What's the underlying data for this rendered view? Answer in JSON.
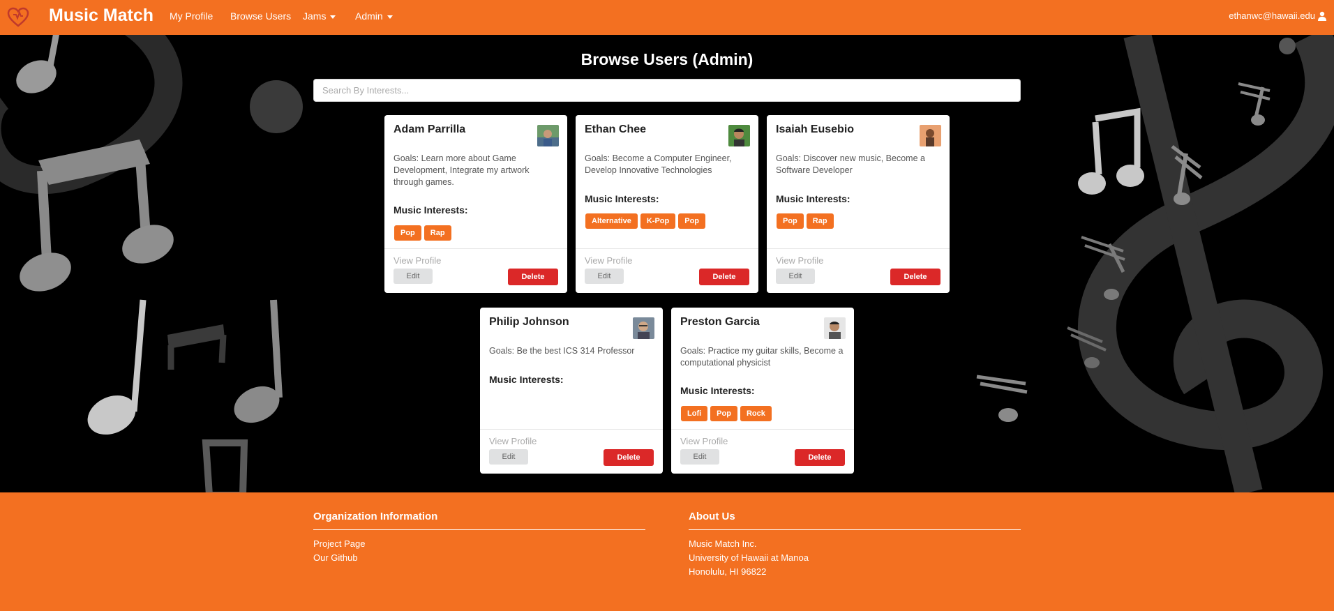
{
  "nav": {
    "brand": "Music Match",
    "links": [
      "My Profile",
      "Browse Users",
      "Jams",
      "Admin"
    ],
    "user": "ethanwc@hawaii.edu"
  },
  "page": {
    "title": "Browse Users (Admin)",
    "search_placeholder": "Search By Interests..."
  },
  "labels": {
    "music_interests": "Music Interests:",
    "view_profile": "View Profile",
    "edit": "Edit",
    "delete": "Delete"
  },
  "users": [
    {
      "name": "Adam Parrilla",
      "goals": "Goals: Learn more about Game Development, Integrate my artwork through games.",
      "interests": [
        "Pop",
        "Rap"
      ]
    },
    {
      "name": "Ethan Chee",
      "goals": "Goals: Become a Computer Engineer, Develop Innovative Technologies",
      "interests": [
        "Alternative",
        "K-Pop",
        "Pop"
      ]
    },
    {
      "name": "Isaiah Eusebio",
      "goals": "Goals: Discover new music, Become a Software Developer",
      "interests": [
        "Pop",
        "Rap"
      ]
    },
    {
      "name": "Philip Johnson",
      "goals": "Goals: Be the best ICS 314 Professor",
      "interests": []
    },
    {
      "name": "Preston Garcia",
      "goals": "Goals: Practice my guitar skills, Become a computational physicist",
      "interests": [
        "Lofi",
        "Pop",
        "Rock"
      ]
    }
  ],
  "footer": {
    "org": {
      "title": "Organization Information",
      "links": [
        "Project Page",
        "Our Github"
      ]
    },
    "about": {
      "title": "About Us",
      "lines": [
        "Music Match Inc.",
        "University of Hawaii at Manoa",
        "Honolulu, HI 96822"
      ]
    }
  },
  "colors": {
    "brand": "#f37021",
    "danger": "#db2828",
    "page_bg": "#000000"
  }
}
